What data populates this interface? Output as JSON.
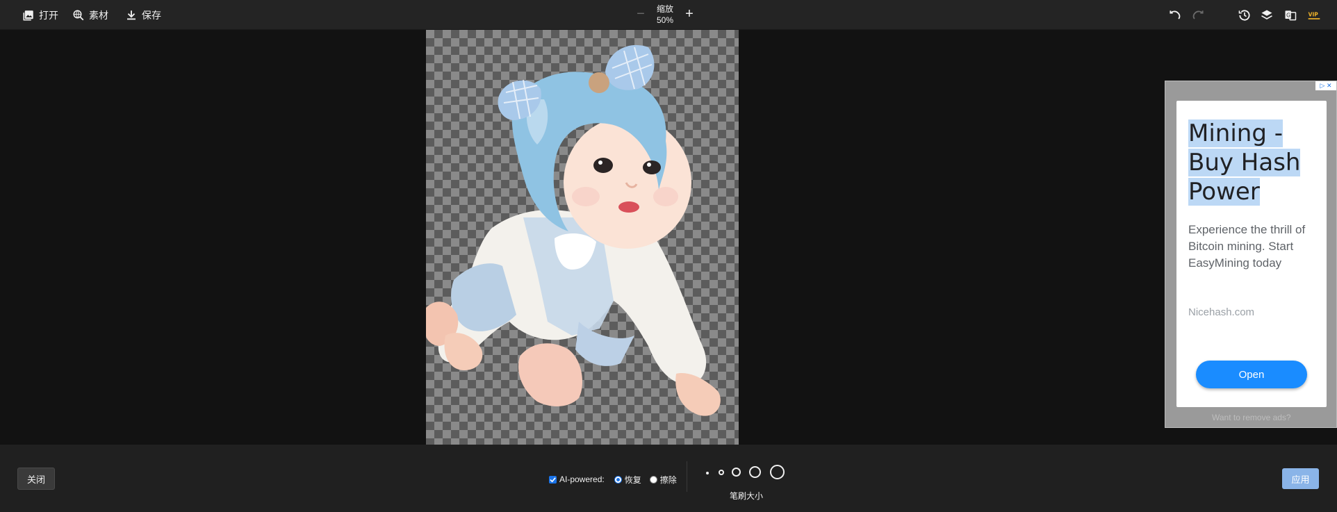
{
  "toolbar": {
    "open_label": "打开",
    "assets_label": "素材",
    "save_label": "保存",
    "zoom_label": "缩放",
    "zoom_value": "50%",
    "zoom_minus": "−",
    "zoom_plus": "+",
    "vip_label": "VIP",
    "icons": [
      "image-icon",
      "search-globe-icon",
      "download-icon",
      "undo-icon",
      "redo-icon",
      "history-icon",
      "layers-icon",
      "translate-icon",
      "vip-icon"
    ]
  },
  "ad": {
    "title": "Mining - Buy Hash Power",
    "title_lines": [
      "Mining -",
      "Buy Hash",
      "Power"
    ],
    "description": "Experience the thrill of Bitcoin mining. Start EasyMining today",
    "domain": "Nicehash.com",
    "cta": "Open",
    "badge": "▷ ✕",
    "remove_ads": "Want to remove ads?"
  },
  "bottom": {
    "close_label": "关闭",
    "apply_label": "应用",
    "ai_label": "AI-powered:",
    "ai_checked": true,
    "restore_label": "恢复",
    "erase_label": "擦除",
    "selected_mode": "restore",
    "brush_size_label": "笔刷大小",
    "brush_sizes": [
      1,
      2,
      3,
      4,
      5
    ]
  },
  "colors": {
    "toolbar_bg": "#242424",
    "canvas_bg": "#121212",
    "accent": "#1a73e8",
    "apply_bg": "#8ab4e8",
    "vip": "#f0b429",
    "ad_button": "#1a8cff"
  }
}
